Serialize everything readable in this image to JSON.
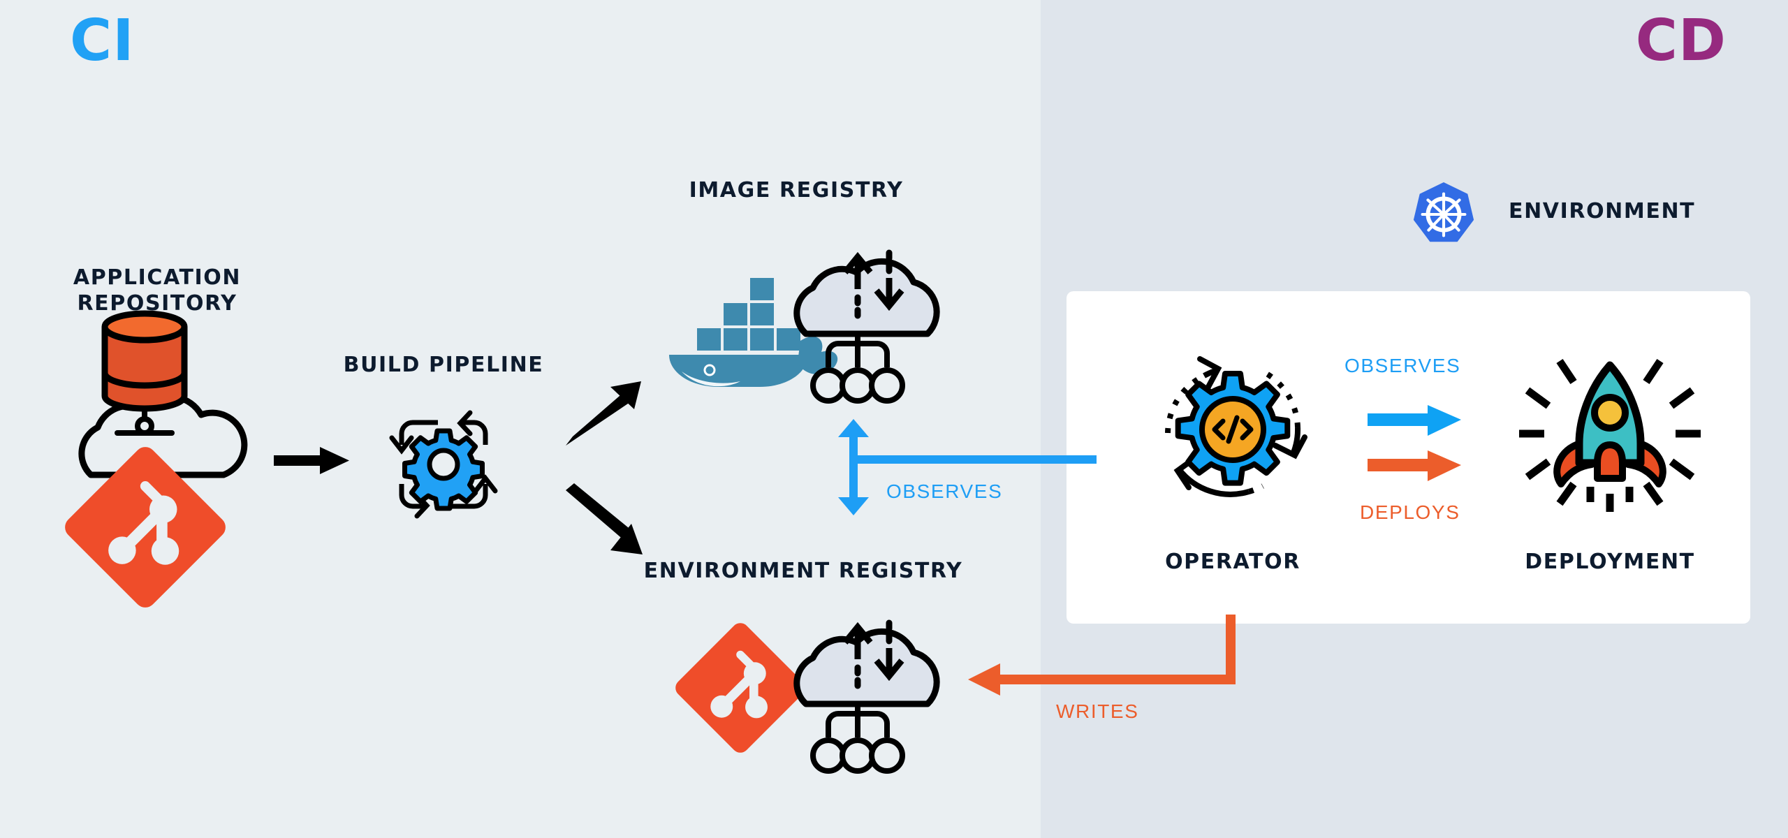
{
  "sections": {
    "ci": {
      "tag": "CI"
    },
    "cd": {
      "tag": "CD"
    }
  },
  "colors": {
    "bg_ci": "#eaeff2",
    "bg_cd": "#dfe5ec",
    "panel": "#ffffff",
    "ci_accent": "#21A1F5",
    "cd_accent": "#962A7F",
    "label_dark": "#0d1b2e",
    "blue_arrow": "#1E9EF5",
    "orange_arrow": "#EC5D2B",
    "git_red": "#EF4D2A",
    "docker_blue": "#3E8AAE",
    "kubernetes_blue": "#326CE5",
    "gear_blue": "#21A1F5",
    "code_amber": "#F5A623",
    "rocket_teal": "#3DBFC4",
    "cloud_fill": "#dde3ec",
    "db_orange": "#E0522B"
  },
  "nodes": {
    "application_repository": {
      "label": "APPLICATION\nREPOSITORY",
      "icons": [
        "database-icon",
        "cloud-icon",
        "git-logo-icon"
      ]
    },
    "build_pipeline": {
      "label": "BUILD PIPELINE",
      "icons": [
        "gear-icon",
        "circular-arrows-icon"
      ]
    },
    "image_registry": {
      "label": "IMAGE REGISTRY",
      "icons": [
        "docker-whale-icon",
        "registry-cloud-icon"
      ]
    },
    "environment_registry": {
      "label": "ENVIRONMENT REGISTRY",
      "icons": [
        "git-logo-icon",
        "registry-cloud-icon"
      ]
    },
    "environment": {
      "label": "ENVIRONMENT",
      "icons": [
        "kubernetes-logo-icon"
      ]
    },
    "operator": {
      "label": "OPERATOR",
      "icons": [
        "gear-code-icon",
        "circular-arrows-icon"
      ]
    },
    "deployment": {
      "label": "DEPLOYMENT",
      "icons": [
        "rocket-icon"
      ]
    }
  },
  "edges": {
    "repo_to_pipeline": {
      "label": "",
      "style": "solid-black-arrow",
      "direction": "right"
    },
    "pipeline_to_image": {
      "label": "",
      "style": "solid-black-arrow",
      "direction": "up-right"
    },
    "pipeline_to_envreg": {
      "label": "",
      "style": "solid-black-arrow",
      "direction": "down-right"
    },
    "operator_observes_registries": {
      "label": "OBSERVES",
      "color": "#1E9EF5",
      "direction": "bidirectional-vertical"
    },
    "operator_observes_deployment": {
      "label": "OBSERVES",
      "color": "#1E9EF5",
      "direction": "right"
    },
    "operator_deploys_deployment": {
      "label": "DEPLOYS",
      "color": "#EC5D2B",
      "direction": "right"
    },
    "operator_writes_envregistry": {
      "label": "WRITES",
      "color": "#EC5D2B",
      "direction": "left"
    }
  }
}
